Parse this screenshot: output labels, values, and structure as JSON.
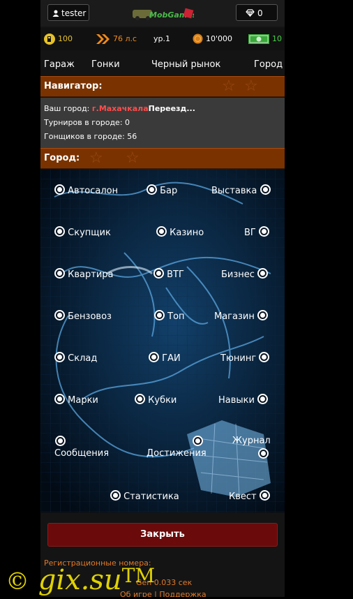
{
  "topbar": {
    "username": "tester",
    "gems": "0",
    "logo_text": "MobGames"
  },
  "stats": {
    "fuel": "100",
    "power": "76 л.с",
    "level": "ур.1",
    "coins": "10'000",
    "cash": "10"
  },
  "nav": {
    "items": [
      "Гараж",
      "Гонки",
      "Черный рынок",
      "Город"
    ]
  },
  "navigator": {
    "title": "Навигатор:",
    "city_label": "Ваш город:",
    "city": "г.Махачкала",
    "move": "Переезд...",
    "tournaments": "Турниров в городе: 0",
    "racers": "Гонщиков в городе: 56"
  },
  "city": {
    "title": "Город:",
    "locations": [
      "Автосалон",
      "Бар",
      "Выставка",
      "Скупщик",
      "Казино",
      "ВГ",
      "Квартира",
      "ВТГ",
      "Бизнес",
      "Бензовоз",
      "Топ",
      "Магазин",
      "Склад",
      "ГАИ",
      "Тюнинг",
      "Марки",
      "Кубки",
      "Навыки",
      "Сообщения",
      "Достижения",
      "Журнал",
      "Статистика",
      "Квест"
    ]
  },
  "close_button": "Закрыть",
  "footer": {
    "reg_numbers": "Регистрационные номера:",
    "gen": "Gen 0.033 сек",
    "about": "Об игре",
    "sep": "|",
    "support": "Поддержка"
  },
  "watermark": {
    "copyright": "©",
    "text": "gix.su",
    "tm": "TM"
  },
  "colors": {
    "header_bg": "#7a3300",
    "accent_red": "#ff4d4d",
    "footer_text": "#e07a2a",
    "close_bg": "#6a0a0a",
    "watermark": "#e0d200"
  }
}
